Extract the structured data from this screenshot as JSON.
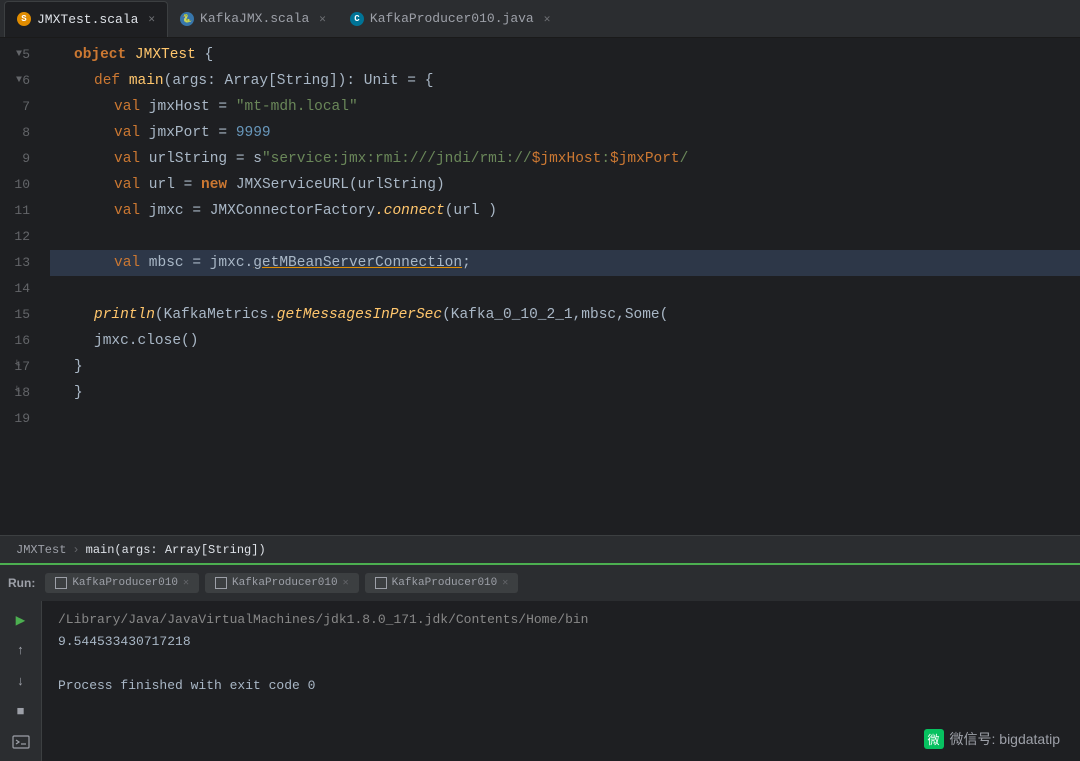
{
  "tabs": [
    {
      "id": "jmxtest",
      "label": "JMXTest.scala",
      "icon_type": "orange",
      "icon_text": "S",
      "active": true
    },
    {
      "id": "kafkajmx",
      "label": "KafkaJMX.scala",
      "icon_type": "python",
      "icon_text": "S",
      "active": false
    },
    {
      "id": "kafkaproducer",
      "label": "KafkaProducer010.java",
      "icon_type": "java",
      "icon_text": "J",
      "active": false
    }
  ],
  "code": {
    "lines": [
      {
        "num": 5,
        "has_run": true,
        "has_fold": false,
        "content_html": "<span class='indent1'><span class='kw'>object</span> <span class='type2'>JMXTest</span> {"
      },
      {
        "num": 6,
        "has_run": true,
        "has_fold": true,
        "content_html": "<span class='indent2'><span class='kw2'>def</span> <span class='fn'>main</span><span class='plain'>(args: </span><span class='type2'>Array</span><span class='plain'>[</span><span class='type2'>String</span><span class='plain'>]): </span><span class='type2'>Unit</span><span class='plain'> = {</span>"
      },
      {
        "num": 7,
        "content_html": "<span class='indent3'><span class='kw2'>val</span> <span class='plain'>jmxHost = </span><span class='str'>\"mt-mdh.local\"</span></span>"
      },
      {
        "num": 8,
        "content_html": "<span class='indent3'><span class='kw2'>val</span> <span class='plain'>jmxPort = </span><span class='num'>9999</span></span>"
      },
      {
        "num": 9,
        "content_html": "<span class='indent3'><span class='kw2'>val</span> <span class='plain'>urlString = s</span><span class='str'>\"service:jmx:rmi:///jndi/rmi://</span><span class='var-interp'>$jmxHost</span><span class='str'>:</span><span class='var-interp'>$jmxPort</span><span class='str'>/</span></span>"
      },
      {
        "num": 10,
        "content_html": "<span class='indent3'><span class='kw2'>val</span> <span class='plain'>url = </span><span class='kw'>new</span> <span class='type2'>JMXServiceURL</span><span class='plain'>(urlString)</span></span>"
      },
      {
        "num": 11,
        "content_html": "<span class='indent3'><span class='kw2'>val</span> <span class='plain'>jmxc = </span><span class='type2'>JMXConnectorFactory</span><span class='fn-italic'>.connect</span><span class='plain'>(url )</span></span>"
      },
      {
        "num": 12,
        "content_html": ""
      },
      {
        "num": 13,
        "is_highlight": true,
        "content_html": "<span class='indent3'><span class='kw2'>val</span> <span class='plain'>mbsc = jmxc.</span><span class='underline-yellow'>getMBeanServerConnection</span><span class='plain'>;</span></span>"
      },
      {
        "num": 14,
        "content_html": ""
      },
      {
        "num": 15,
        "content_html": "<span class='indent2'><span class='fn-italic'>println</span><span class='plain'>(KafkaMetrics.</span><span class='fn-italic'>getMessagesInPerSec</span><span class='plain'>(Kafka_0_10_2_1,mbsc,</span><span class='type2'>Some</span><span class='plain'>(</span></span>"
      },
      {
        "num": 16,
        "content_html": "<span class='indent2'><span class='plain'>jmxc.close()</span></span>"
      },
      {
        "num": 17,
        "has_fold_close": true,
        "content_html": "<span class='indent1'><span class='plain'>}</span></span>"
      },
      {
        "num": 18,
        "has_fold_close": true,
        "content_html": "<span class='indent1'><span class='plain'>}</span></span>"
      },
      {
        "num": 19,
        "content_html": ""
      }
    ]
  },
  "breadcrumb": {
    "items": [
      "JMXTest",
      "main(args: Array[String])"
    ]
  },
  "run_panel": {
    "label": "Run:",
    "tabs": [
      {
        "label": "KafkaProducer010",
        "active": false
      },
      {
        "label": "KafkaProducer010",
        "active": false
      },
      {
        "label": "KafkaProducer010",
        "active": true
      }
    ],
    "output_lines": [
      "/Library/Java/JavaVirtualMachines/jdk1.8.0_171.jdk/Contents/Home/bin",
      "9.544533430717218",
      "",
      "Process finished with exit code 0"
    ]
  },
  "watermark": {
    "icon": "微",
    "text": "微信号: bigdatatip"
  }
}
